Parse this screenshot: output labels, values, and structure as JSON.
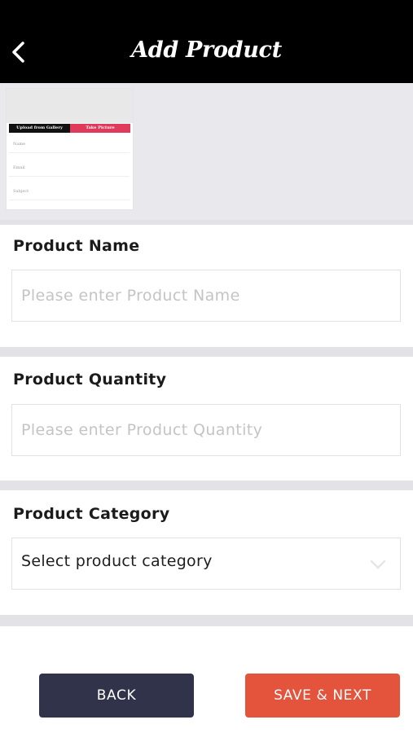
{
  "header": {
    "title": "Add Product",
    "back_icon": "chevron-left-icon"
  },
  "image_preview": {
    "gallery_label": "Upload from Gallery",
    "camera_label": "Take Picture",
    "fields": [
      "Name",
      "Email",
      "Subject"
    ]
  },
  "form": {
    "product_name": {
      "label": "Product Name",
      "placeholder": "Please enter Product Name"
    },
    "product_quantity": {
      "label": "Product Quantity",
      "placeholder": "Please enter Product Quantity"
    },
    "product_category": {
      "label": "Product Category",
      "value": "Select product category",
      "icon": "chevron-down-icon"
    }
  },
  "actions": {
    "back_label": "BACK",
    "next_label": "SAVE & NEXT"
  },
  "colors": {
    "header_bg": "#000000",
    "back_button": "#31334b",
    "next_button": "#e4533c",
    "accent_pink": "#df3a5c"
  }
}
